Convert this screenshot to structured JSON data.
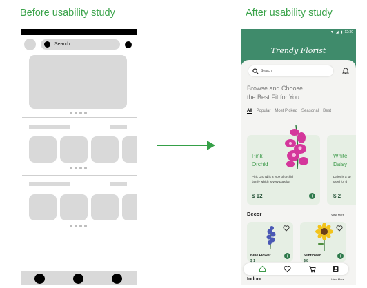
{
  "labels": {
    "before": "Before usability study",
    "after": "After usability study"
  },
  "wireframe": {
    "search_placeholder": "Search"
  },
  "mockup": {
    "status_time": "12:30",
    "brand": "Trendy Florist",
    "search_placeholder": "Search",
    "headline_line1": "Browse and Choose",
    "headline_line2": "the Best Fit for You",
    "tabs": [
      "All",
      "Popular",
      "Most Picked",
      "Seasonal",
      "Best"
    ],
    "products": [
      {
        "name_line1": "Pink",
        "name_line2": "Orchid",
        "desc_line1": "Pink Orchid is a type of orchid",
        "desc_line2": "family which is very popular.",
        "price": "$ 12"
      },
      {
        "name_line1": "White",
        "name_line2": "Daisy",
        "desc_line1": "Daisy is a sp",
        "desc_line2": "used for d",
        "price": "$ 2"
      }
    ],
    "decor_title": "Decor",
    "view_more": "View More",
    "decor_items": [
      {
        "name": "Blue Flower",
        "price": "$ 1"
      },
      {
        "name": "Sunflower",
        "price": "$ 8"
      }
    ],
    "indoor_title": "Indoor",
    "view_more_2": "View More",
    "colors": {
      "header": "#3f8b6b",
      "accent_green": "#3d9a4a",
      "card_bg": "#e6efe4",
      "arrow": "#35a047"
    },
    "icons": [
      "search-icon",
      "bell-icon",
      "heart-icon",
      "home-icon",
      "cart-icon",
      "profile-icon",
      "plus-icon"
    ]
  }
}
